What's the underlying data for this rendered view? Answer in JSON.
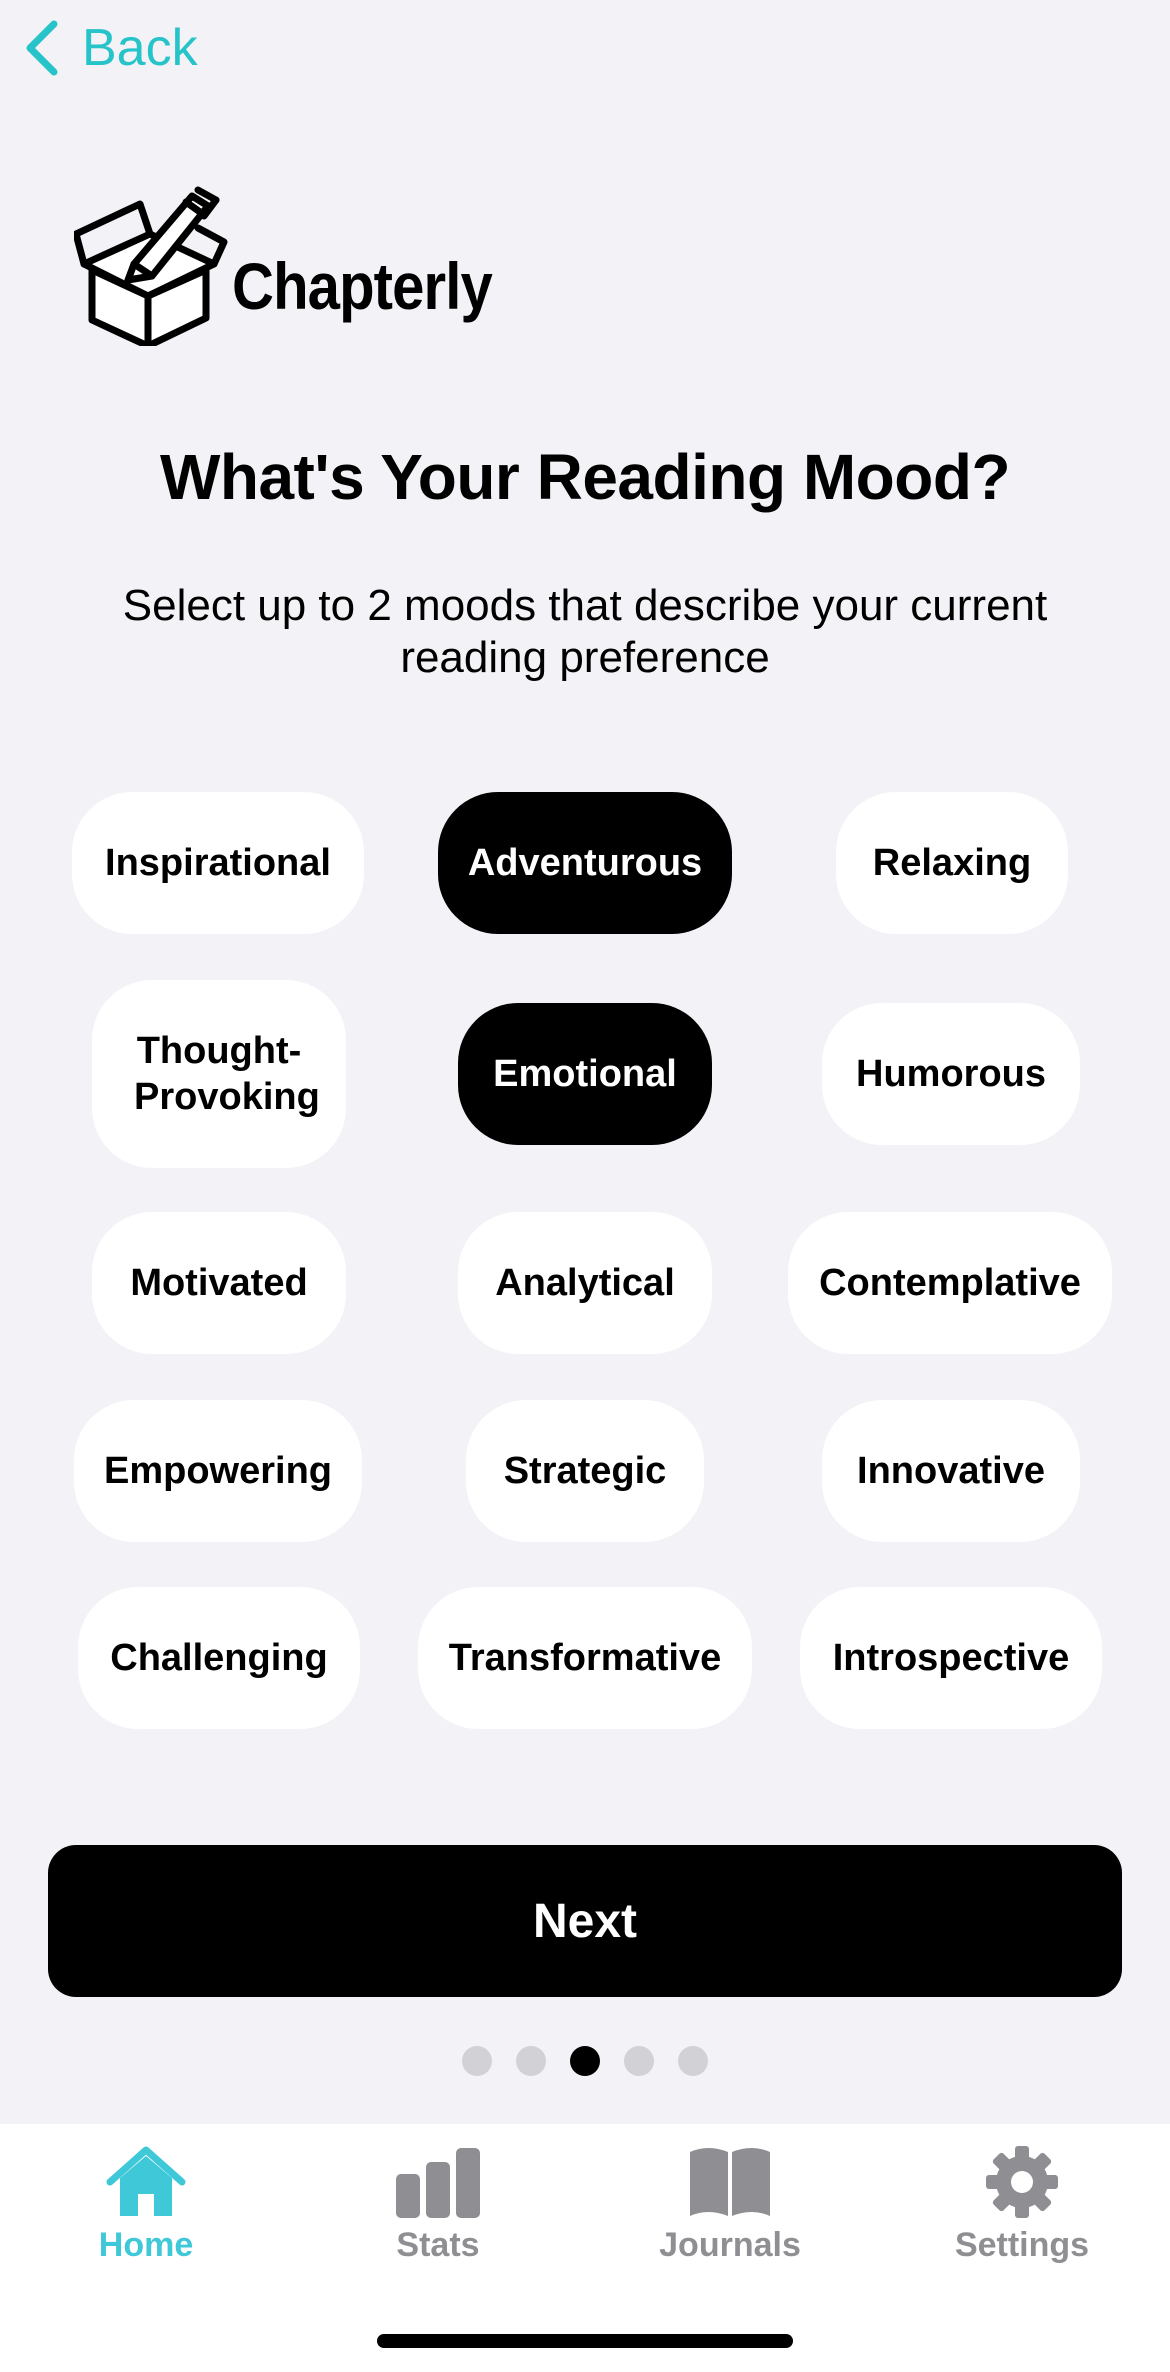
{
  "nav": {
    "back_label": "Back",
    "back_icon": "chevron-left-icon"
  },
  "brand": {
    "name": "Chapterly",
    "logo_icon": "open-box-with-pen-icon"
  },
  "title": "What's Your Reading Mood?",
  "subtitle": "Select up to 2 moods that describe your current reading preference",
  "moods": [
    {
      "label": "Inspirational",
      "selected": false
    },
    {
      "label": "Adventurous",
      "selected": true
    },
    {
      "label": "Relaxing",
      "selected": false
    },
    {
      "label": "Thought-Provoking",
      "selected": false
    },
    {
      "label": "Emotional",
      "selected": true
    },
    {
      "label": "Humorous",
      "selected": false
    },
    {
      "label": "Motivated",
      "selected": false
    },
    {
      "label": "Analytical",
      "selected": false
    },
    {
      "label": "Contemplative",
      "selected": false
    },
    {
      "label": "Empowering",
      "selected": false
    },
    {
      "label": "Strategic",
      "selected": false
    },
    {
      "label": "Innovative",
      "selected": false
    },
    {
      "label": "Challenging",
      "selected": false
    },
    {
      "label": "Transformative",
      "selected": false
    },
    {
      "label": "Introspective",
      "selected": false
    }
  ],
  "next_label": "Next",
  "pagination": {
    "current_page": 3,
    "total_pages": 5
  },
  "tabs": [
    {
      "label": "Home",
      "icon": "house-icon",
      "active": true
    },
    {
      "label": "Stats",
      "icon": "bar-chart-icon",
      "active": false
    },
    {
      "label": "Journals",
      "icon": "open-book-icon",
      "active": false
    },
    {
      "label": "Settings",
      "icon": "gear-icon",
      "active": false
    }
  ],
  "colors": {
    "accent": "#26c3c8",
    "tab_active": "#3ec8d8",
    "tab_inactive": "#8e8e93",
    "background": "#f2f2f7",
    "selected_chip": "#000000"
  }
}
